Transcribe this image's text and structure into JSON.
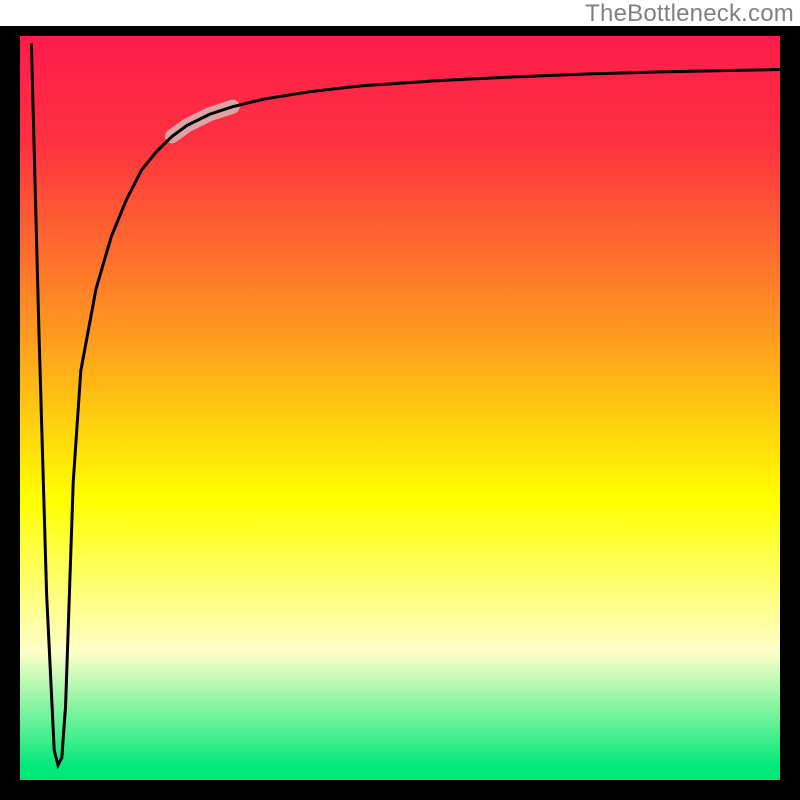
{
  "attribution": "TheBottleneck.com",
  "colors": {
    "frame": "#000000",
    "curve": "#000000",
    "highlight": "#dba5a5",
    "gradient_top": "#ff1a4d",
    "gradient_mid_upper": "#ff9820",
    "gradient_mid": "#ffff00",
    "gradient_mid_lower": "#fdffc8",
    "gradient_bottom": "#00e87a"
  },
  "chart_data": {
    "type": "line",
    "title": "",
    "xlabel": "",
    "ylabel": "",
    "xlim": [
      0,
      100
    ],
    "ylim": [
      0,
      100
    ],
    "grid": false,
    "series": [
      {
        "name": "bottleneck-curve",
        "x": [
          1.5,
          2.5,
          3.5,
          4.5,
          5.0,
          5.5,
          6.0,
          6.5,
          7.0,
          8.0,
          10.0,
          12.0,
          14.0,
          16.0,
          18.0,
          20.0,
          22.0,
          25.0,
          28.0,
          32.0,
          38.0,
          45.0,
          55.0,
          65.0,
          75.0,
          85.0,
          95.0,
          100.0
        ],
        "y": [
          99.0,
          60.0,
          25.0,
          4.0,
          2.0,
          3.0,
          10.0,
          25.0,
          40.0,
          55.0,
          66.0,
          73.0,
          78.0,
          82.0,
          84.5,
          86.5,
          88.0,
          89.5,
          90.5,
          91.5,
          92.5,
          93.3,
          94.0,
          94.5,
          94.9,
          95.2,
          95.4,
          95.5
        ]
      }
    ],
    "highlight_segment": {
      "x_start": 20,
      "x_end": 28
    },
    "background_gradient": {
      "orientation": "vertical",
      "stops": [
        {
          "pos": 0.0,
          "color": "#ff1a4d"
        },
        {
          "pos": 0.15,
          "color": "#ff3040"
        },
        {
          "pos": 0.4,
          "color": "#ff9820"
        },
        {
          "pos": 0.62,
          "color": "#ffff00"
        },
        {
          "pos": 0.82,
          "color": "#fdffc8"
        },
        {
          "pos": 0.97,
          "color": "#00e87a"
        },
        {
          "pos": 1.0,
          "color": "#00e87a"
        }
      ]
    }
  }
}
